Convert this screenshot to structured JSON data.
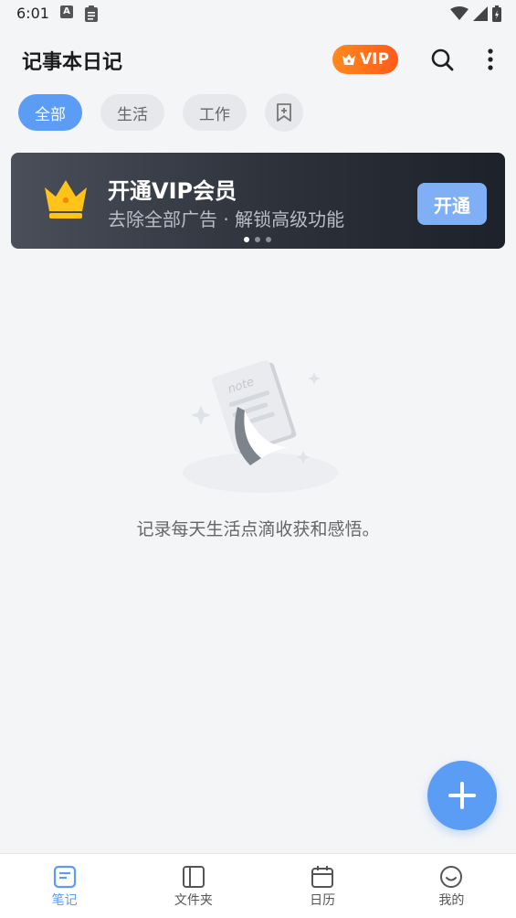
{
  "status_bar": {
    "time": "6:01",
    "icons_left": [
      "a-notification-icon",
      "clipboard-icon"
    ],
    "icons_right": [
      "wifi-icon",
      "signal-icon",
      "battery-icon"
    ]
  },
  "header": {
    "title": "记事本日记",
    "vip_label": "VIP",
    "icons": [
      "search-icon",
      "more-vertical-icon"
    ]
  },
  "tabs": [
    {
      "label": "全部",
      "active": true
    },
    {
      "label": "生活",
      "active": false
    },
    {
      "label": "工作",
      "active": false
    }
  ],
  "banner": {
    "title": "开通VIP会员",
    "subtitle": "去除全部广告 · 解锁高级功能",
    "button_label": "开通",
    "page_indicator": {
      "count": 3,
      "active": 1
    }
  },
  "empty_state": {
    "message": "记录每天生活点滴收获和感悟。"
  },
  "bottom_nav": [
    {
      "label": "笔记",
      "icon": "notes-icon",
      "active": true
    },
    {
      "label": "文件夹",
      "icon": "folder-icon",
      "active": false
    },
    {
      "label": "日历",
      "icon": "calendar-icon",
      "active": false
    },
    {
      "label": "我的",
      "icon": "profile-smile-icon",
      "active": false
    }
  ],
  "colors": {
    "accent": "#5b9cf5",
    "vip_orange": "#ff7a1f",
    "background": "#f4f5f7"
  }
}
